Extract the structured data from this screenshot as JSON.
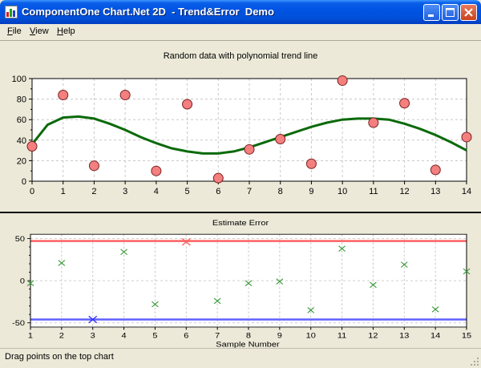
{
  "window": {
    "title": "ComponentOne Chart.Net 2D  - Trend&Error  Demo"
  },
  "menu": {
    "items": [
      {
        "key": "F",
        "rest": "ile"
      },
      {
        "key": "V",
        "rest": "iew"
      },
      {
        "key": "H",
        "rest": "elp"
      }
    ]
  },
  "status": {
    "text": "Drag points on the top chart"
  },
  "colors": {
    "trend_line": "#0a6a0a",
    "marker_fill": "#f47f7f",
    "upper_limit": "#ff6060",
    "lower_limit": "#6060ff",
    "error_marker": "#3a9a3a",
    "error_marker_highlight": "#3030ff"
  },
  "chart_data": [
    {
      "type": "scatter",
      "title": "Random data with polynomial trend line",
      "xlim": [
        0,
        14
      ],
      "ylim": [
        0,
        100
      ],
      "x_ticks": [
        0,
        1,
        2,
        3,
        4,
        5,
        6,
        7,
        8,
        9,
        10,
        11,
        12,
        13,
        14
      ],
      "y_ticks": [
        0,
        20,
        40,
        60,
        80,
        100
      ],
      "grid": true,
      "series": [
        {
          "x": [
            0,
            1,
            2,
            3,
            4,
            5,
            6,
            7,
            8,
            9,
            10,
            11,
            12,
            13,
            14
          ],
          "y": [
            34,
            84,
            15,
            84,
            10,
            75,
            3,
            31,
            41,
            17,
            98,
            57,
            76,
            11,
            43
          ]
        }
      ],
      "trend_line": {
        "type": "polynomial",
        "x": [
          0,
          0.5,
          1,
          1.5,
          2,
          2.5,
          3,
          3.5,
          4,
          4.5,
          5,
          5.5,
          6,
          6.5,
          7,
          7.5,
          8,
          8.5,
          9,
          9.5,
          10,
          10.5,
          11,
          11.5,
          12,
          12.5,
          13,
          13.5,
          14
        ],
        "y": [
          36,
          55,
          62,
          63,
          61,
          56,
          50,
          43,
          37,
          32,
          29,
          27,
          27,
          29,
          33,
          38,
          43,
          48,
          53,
          57,
          60,
          61,
          61,
          60,
          56,
          51,
          45,
          38,
          30
        ]
      }
    },
    {
      "type": "scatter",
      "title": "Estimate Error",
      "xlabel": "Sample Number",
      "xlim": [
        1,
        15
      ],
      "ylim": [
        -55,
        55
      ],
      "x_ticks": [
        1,
        2,
        3,
        4,
        5,
        6,
        7,
        8,
        9,
        10,
        11,
        12,
        13,
        14,
        15
      ],
      "y_ticks": [
        -50,
        0,
        50
      ],
      "grid": true,
      "upper_limit": 47,
      "lower_limit": -46,
      "series": [
        {
          "x": [
            1,
            2,
            3,
            4,
            5,
            6,
            7,
            8,
            9,
            10,
            11,
            12,
            13,
            14,
            15
          ],
          "y": [
            -3,
            21,
            -46,
            34,
            -28,
            46,
            -24,
            -3,
            -1,
            -35,
            38,
            -5,
            19,
            -34,
            11
          ]
        }
      ],
      "highlighted_indices": [
        2,
        5
      ]
    }
  ]
}
